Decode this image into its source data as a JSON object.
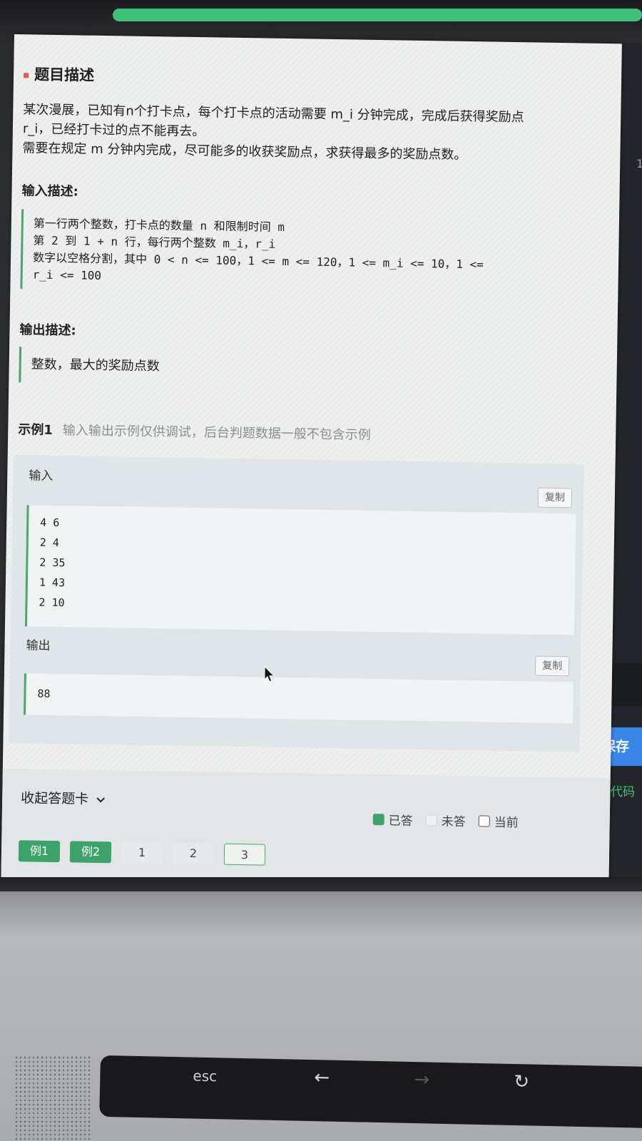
{
  "problem": {
    "section_title": "题目描述",
    "description": [
      "某次漫展，已知有n个打卡点，每个打卡点的活动需要 m_i 分钟完成，完成后获得奖励点",
      "r_i，已经打卡过的点不能再去。",
      "需要在规定 m 分钟内完成，尽可能多的收获奖励点，求获得最多的奖励点数。"
    ],
    "input_title": "输入描述:",
    "input_lines": [
      "第一行两个整数，打卡点的数量 n 和限制时间 m",
      "第 2 到 1 + n 行，每行两个整数 m_i，r_i",
      "数字以空格分割，其中 0 < n <= 100，1 <= m <= 120，1 <= m_i <= 10，1 <=",
      "r_i <= 100"
    ],
    "output_title": "输出描述:",
    "output_desc": "整数，最大的奖励点数"
  },
  "example": {
    "title": "示例1",
    "note": "输入输出示例仅供调试，后台判题数据一般不包含示例",
    "input_label": "输入",
    "input_lines": [
      "4 6",
      "2 4",
      "2 35",
      "1 43",
      "2 10"
    ],
    "output_label": "输出",
    "output_lines": [
      "88"
    ],
    "copy_label": "复制"
  },
  "answer_card": {
    "collapse_label": "收起答题卡",
    "legend": {
      "answered": "已答",
      "unanswered": "未答",
      "current": "当前"
    },
    "buttons": [
      {
        "label": "例1",
        "state": "answered"
      },
      {
        "label": "例2",
        "state": "answered"
      },
      {
        "label": "1",
        "state": "unanswered"
      },
      {
        "label": "2",
        "state": "unanswered"
      },
      {
        "label": "3",
        "state": "current"
      }
    ]
  },
  "side_panel": {
    "number": "1",
    "save_label": "保存",
    "code_tip": "你的代码"
  },
  "keyboard": {
    "esc_label": "esc"
  },
  "colors": {
    "accent": "#3ea36a",
    "save_button": "#3a86e6",
    "marker": "#e25a4f"
  }
}
